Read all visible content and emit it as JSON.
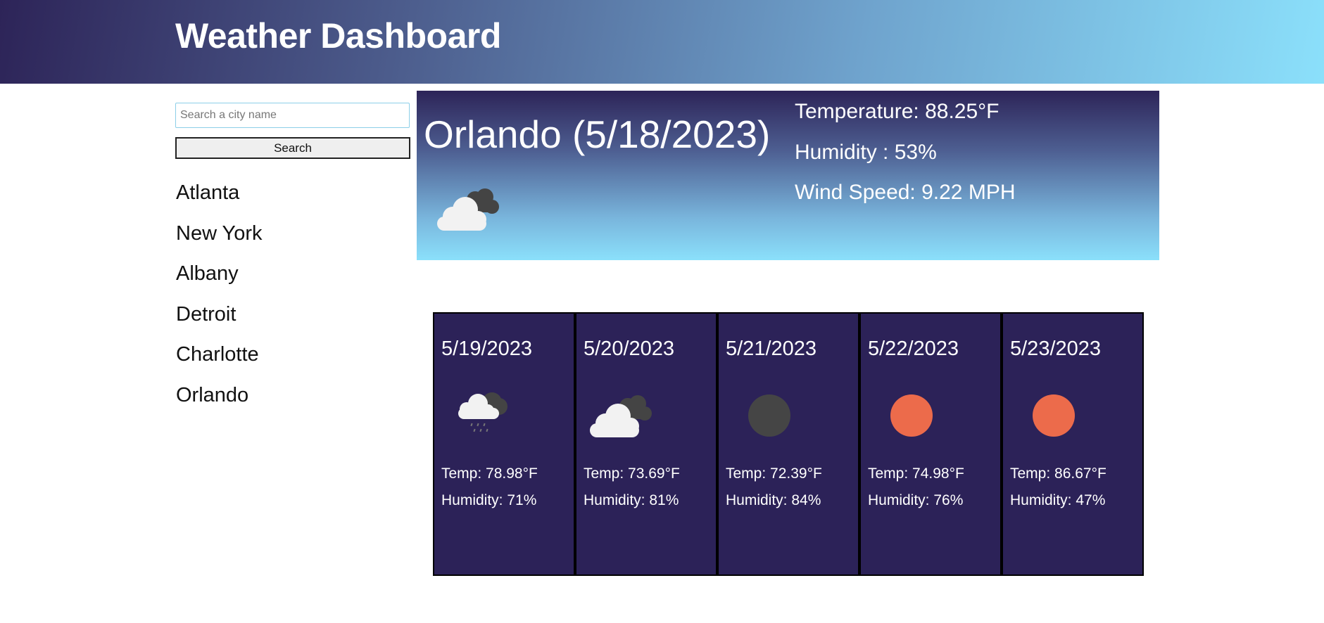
{
  "header": {
    "title": "Weather Dashboard"
  },
  "search": {
    "placeholder": "Search a city name",
    "button_label": "Search"
  },
  "history": [
    "Atlanta",
    "New York",
    "Albany",
    "Detroit",
    "Charlotte",
    "Orlando"
  ],
  "current": {
    "city_date": "Orlando (5/18/2023)",
    "temperature": "Temperature: 88.25°F",
    "humidity": "Humidity : 53%",
    "wind": "Wind Speed: 9.22 MPH",
    "icon": "broken-clouds-icon"
  },
  "forecast": [
    {
      "date": "5/19/2023",
      "icon": "rain-cloud-icon",
      "temp": "Temp: 78.98°F",
      "humidity": "Humidity: 71%"
    },
    {
      "date": "5/20/2023",
      "icon": "broken-clouds-icon",
      "temp": "Temp: 73.69°F",
      "humidity": "Humidity: 81%"
    },
    {
      "date": "5/21/2023",
      "icon": "moon-icon",
      "temp": "Temp: 72.39°F",
      "humidity": "Humidity: 84%"
    },
    {
      "date": "5/22/2023",
      "icon": "sun-icon",
      "temp": "Temp: 74.98°F",
      "humidity": "Humidity: 76%"
    },
    {
      "date": "5/23/2023",
      "icon": "sun-icon",
      "temp": "Temp: 86.67°F",
      "humidity": "Humidity: 47%"
    }
  ],
  "colors": {
    "card_bg": "#2c2258",
    "sun": "#ec6b4b",
    "moon": "#454545",
    "cloud_light": "#f2f2f2",
    "cloud_dark": "#444444"
  }
}
